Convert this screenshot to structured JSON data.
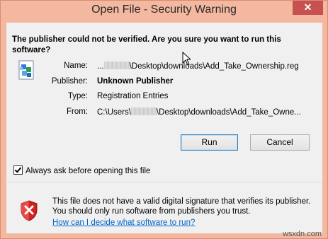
{
  "window": {
    "title": "Open File - Security Warning",
    "close_label": "✕"
  },
  "question": "The publisher could not be verified.  Are you sure you want to run this software?",
  "fields": {
    "name_label": "Name:",
    "name_prefix": "...",
    "name_value": "\\Desktop\\downloads\\Add_Take_Ownership.reg",
    "publisher_label": "Publisher:",
    "publisher_value": "Unknown Publisher",
    "type_label": "Type:",
    "type_value": "Registration Entries",
    "from_label": "From:",
    "from_prefix": "C:\\Users\\",
    "from_value": "\\Desktop\\downloads\\Add_Take_Owne..."
  },
  "buttons": {
    "run": "Run",
    "cancel": "Cancel"
  },
  "checkbox": {
    "label": "Always ask before opening this file",
    "checked": true
  },
  "warning": {
    "text": "This file does not have a valid digital signature that verifies its publisher.  You should only run software from publishers you trust.",
    "link": "How can I decide what software to run?"
  },
  "icons": {
    "file": "registry-file-icon",
    "shield": "shield-error-icon"
  },
  "watermark": "wsxdn.com"
}
